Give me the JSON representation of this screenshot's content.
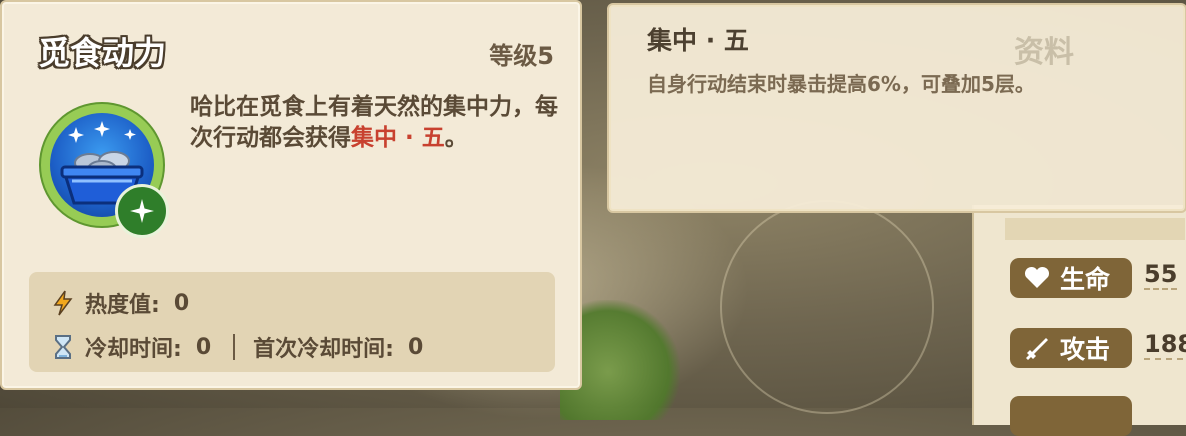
{
  "skill": {
    "name": "觅食动力",
    "level": "等级5",
    "description_pre": "哈比在觅食上有着天然的集中力，每次行动都会获得",
    "description_highlight": "集中 · 五",
    "description_post": "。",
    "heat_label": "热度值:",
    "heat_value": "0",
    "cooldown_label": "冷却时间:",
    "cooldown_value": "0",
    "first_cooldown_label": "首次冷却时间:",
    "first_cooldown_value": "0"
  },
  "tooltip": {
    "title": "集中 · 五",
    "body": "自身行动结束时暴击提高6%，可叠加5层。"
  },
  "background": {
    "watermark": "资料",
    "stats": [
      {
        "label": "生命",
        "value": "55",
        "icon": "heart-icon"
      },
      {
        "label": "攻击",
        "value": "188",
        "icon": "sword-icon"
      }
    ]
  },
  "colors": {
    "highlight": "#c8412f",
    "card_bg": "#f3ead7",
    "stat_pill": "#7f6538"
  }
}
